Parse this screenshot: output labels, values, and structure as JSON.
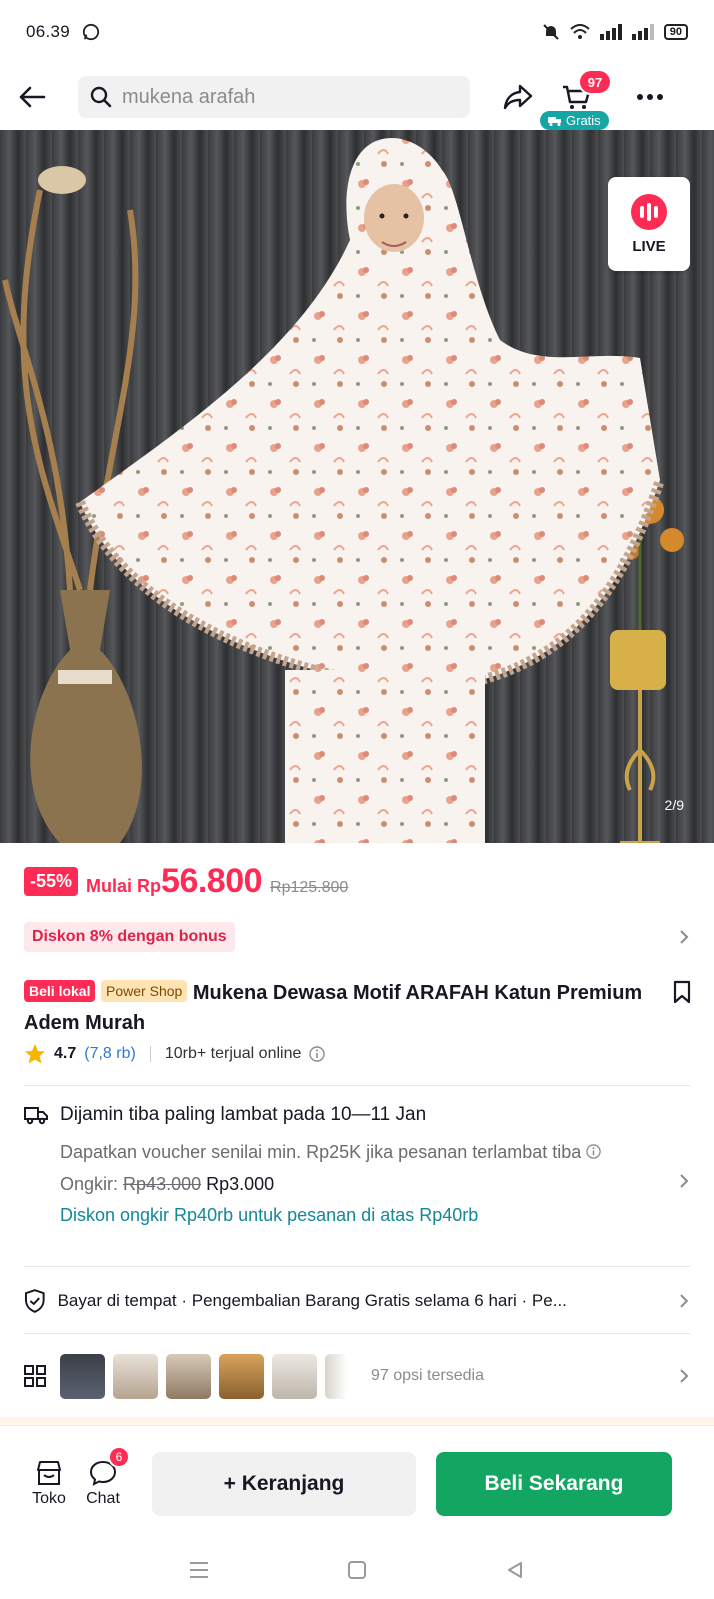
{
  "status": {
    "time": "06.39",
    "battery": "90"
  },
  "nav": {
    "search_text": "mukena arafah",
    "cart_count": "97",
    "cart_label": "Gratis"
  },
  "hero": {
    "live_label": "LIVE",
    "image_counter": "2/9"
  },
  "price": {
    "discount": "-55%",
    "prefix": "Mulai Rp",
    "amount": "56.800",
    "original": "Rp125.800"
  },
  "bonus": {
    "label": "Diskon 8% dengan bonus"
  },
  "product": {
    "tag_local": "Beli lokal",
    "tag_shop": "Power Shop",
    "title": "Mukena Dewasa Motif ARAFAH Katun Premium Adem Murah"
  },
  "rating": {
    "value": "4.7",
    "count": "(7,8 rb)",
    "sold": "10rb+ terjual online"
  },
  "shipping": {
    "guarantee": "Dijamin tiba paling lambat pada 10—11 Jan",
    "voucher": "Dapatkan voucher senilai min. Rp25K jika pesanan terlambat tiba",
    "ongkir_label": "Ongkir:",
    "ongkir_old": "Rp43.000",
    "ongkir_new": "Rp3.000",
    "promo": "Diskon ongkir Rp40rb untuk pesanan di atas Rp40rb"
  },
  "service": {
    "text": "Bayar di tempat · Pengembalian Barang Gratis selama 6 hari · Pe..."
  },
  "variants": {
    "count_text": "97 opsi tersedia"
  },
  "bottom": {
    "shop_label": "Toko",
    "chat_label": "Chat",
    "chat_badge": "6",
    "cart_button": "+ Keranjang",
    "buy_button": "Beli Sekarang"
  },
  "colors": {
    "accent": "#fe2c55",
    "buy": "#13a662",
    "teal": "#14879b"
  }
}
